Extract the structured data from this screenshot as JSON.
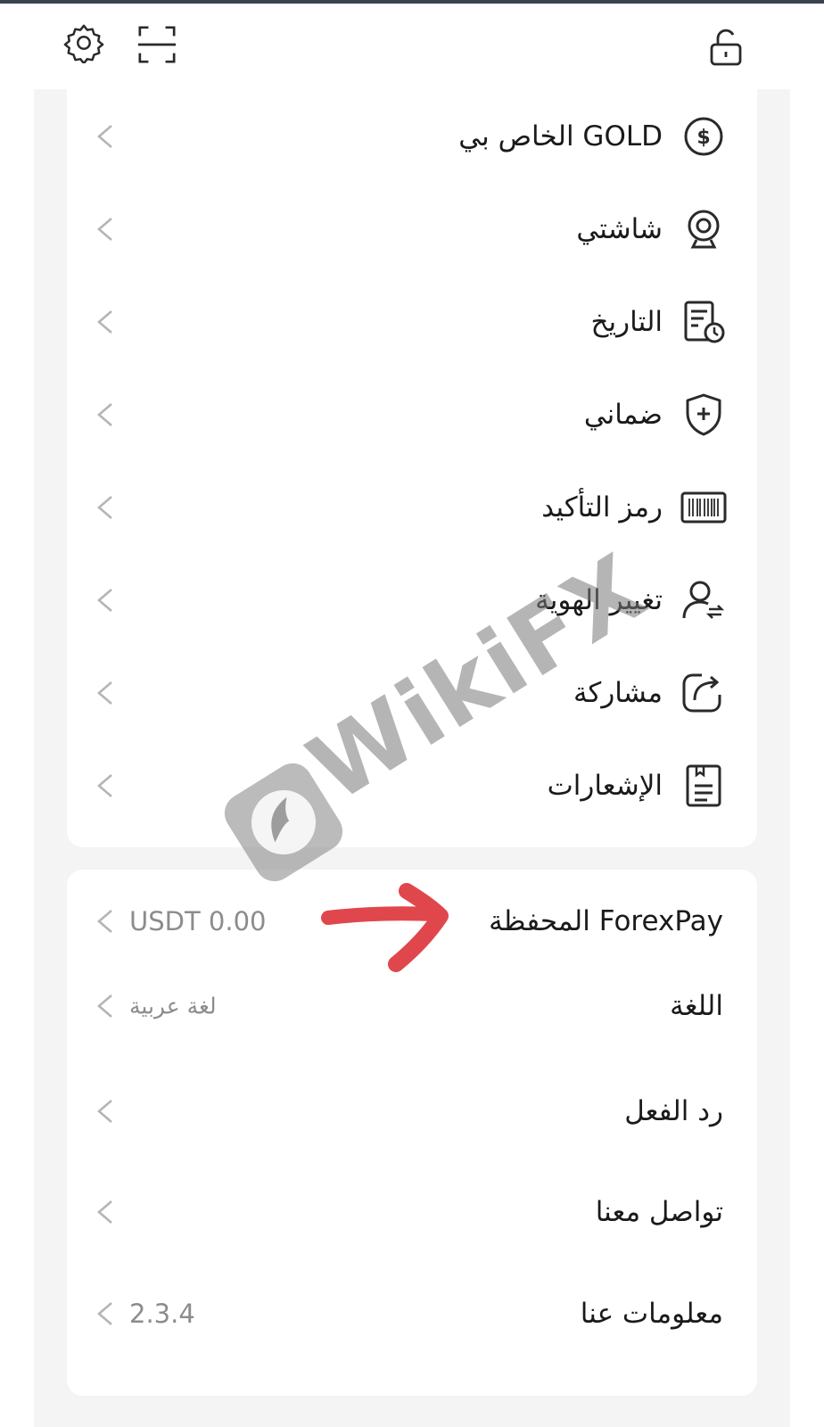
{
  "topbar": {
    "icons": [
      "gear-icon",
      "scan-icon",
      "unlock-icon"
    ]
  },
  "menu_group_1": [
    {
      "label": "GOLD الخاص بي",
      "icon": "dollar-circle-icon"
    },
    {
      "label": "شاشتي",
      "icon": "webcam-icon"
    },
    {
      "label": "التاريخ",
      "icon": "history-document-icon"
    },
    {
      "label": "ضماني",
      "icon": "shield-plus-icon"
    },
    {
      "label": "رمز التأكيد",
      "icon": "barcode-icon"
    },
    {
      "label": "تغيير الهوية",
      "icon": "user-switch-icon"
    },
    {
      "label": "مشاركة",
      "icon": "share-icon"
    },
    {
      "label": "الإشعارات",
      "icon": "notification-doc-icon"
    }
  ],
  "menu_group_2": [
    {
      "label": "ForexPay المحفظة",
      "value": "USDT 0.00"
    },
    {
      "label": "اللغة",
      "value": "لغة عربية"
    },
    {
      "label": "رد الفعل",
      "value": ""
    },
    {
      "label": "تواصل معنا",
      "value": ""
    },
    {
      "label": "معلومات عنا",
      "value": "2.3.4"
    }
  ],
  "watermark": {
    "text": "WikiFX"
  },
  "colors": {
    "annotation_arrow": "#e0474c",
    "chevron": "#b5b5b5",
    "value_text": "#8c8c8c"
  }
}
